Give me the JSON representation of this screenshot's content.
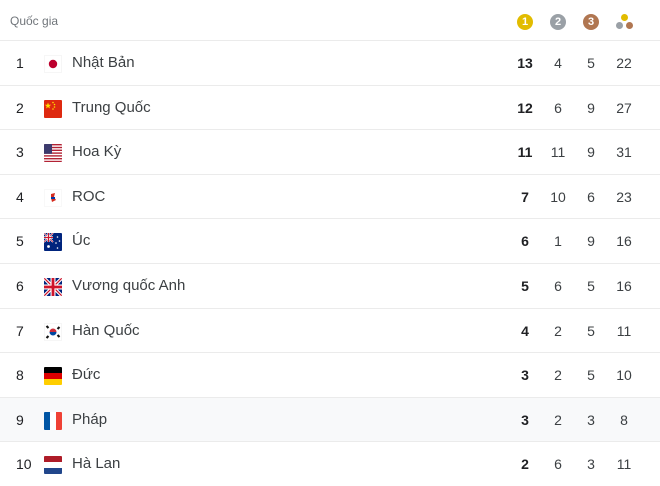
{
  "header": {
    "country_label": "Quốc gia",
    "gold_label": "1",
    "silver_label": "2",
    "bronze_label": "3"
  },
  "colors": {
    "gold": "#e2bc00",
    "silver": "#9aa0a6",
    "bronze": "#b07651"
  },
  "rows": [
    {
      "rank": "1",
      "country": "Nhật Bản",
      "flag": "japan-flag-icon",
      "gold": "13",
      "silver": "4",
      "bronze": "5",
      "total": "22"
    },
    {
      "rank": "2",
      "country": "Trung Quốc",
      "flag": "china-flag-icon",
      "gold": "12",
      "silver": "6",
      "bronze": "9",
      "total": "27"
    },
    {
      "rank": "3",
      "country": "Hoa Kỳ",
      "flag": "usa-flag-icon",
      "gold": "11",
      "silver": "11",
      "bronze": "9",
      "total": "31"
    },
    {
      "rank": "4",
      "country": "ROC",
      "flag": "roc-flag-icon",
      "gold": "7",
      "silver": "10",
      "bronze": "6",
      "total": "23"
    },
    {
      "rank": "5",
      "country": "Úc",
      "flag": "australia-flag-icon",
      "gold": "6",
      "silver": "1",
      "bronze": "9",
      "total": "16"
    },
    {
      "rank": "6",
      "country": "Vương quốc Anh",
      "flag": "uk-flag-icon",
      "gold": "5",
      "silver": "6",
      "bronze": "5",
      "total": "16"
    },
    {
      "rank": "7",
      "country": "Hàn Quốc",
      "flag": "south-korea-flag-icon",
      "gold": "4",
      "silver": "2",
      "bronze": "5",
      "total": "11"
    },
    {
      "rank": "8",
      "country": "Đức",
      "flag": "germany-flag-icon",
      "gold": "3",
      "silver": "2",
      "bronze": "5",
      "total": "10"
    },
    {
      "rank": "9",
      "country": "Pháp",
      "flag": "france-flag-icon",
      "gold": "3",
      "silver": "2",
      "bronze": "3",
      "total": "8"
    },
    {
      "rank": "10",
      "country": "Hà Lan",
      "flag": "netherlands-flag-icon",
      "gold": "2",
      "silver": "6",
      "bronze": "3",
      "total": "11"
    }
  ]
}
